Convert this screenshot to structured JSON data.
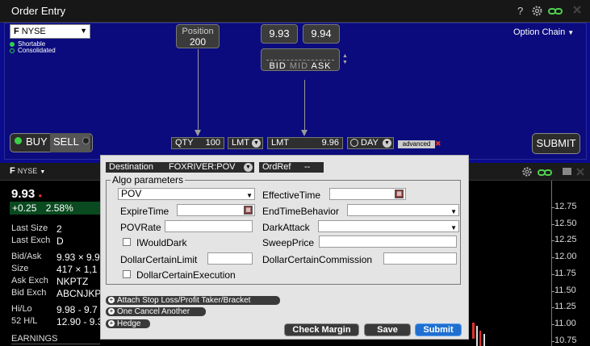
{
  "window": {
    "title": "Order Entry",
    "help": "?"
  },
  "symbol": {
    "ticker": "F",
    "exchange": "NYSE",
    "shortable": "Shortable",
    "consolidated": "Consolidated"
  },
  "position": {
    "label": "Position",
    "value": "200"
  },
  "quote": {
    "bid": "9.93",
    "ask": "9.94",
    "bid_label": "BID",
    "mid_label": "MID",
    "ask_label": "ASK"
  },
  "option_chain": "Option Chain",
  "side": {
    "buy": "BUY",
    "sell": "SELL"
  },
  "order": {
    "qty_label": "QTY",
    "qty": "100",
    "type1": "LMT",
    "type2": "LMT",
    "limit_price": "9.96",
    "tif": "DAY",
    "advanced": "advanced",
    "submit": "SUBMIT"
  },
  "quote_panel": {
    "symbol": "F",
    "exchange": "NYSE",
    "last": "9.93",
    "change": "+0.25",
    "change_pct": "2.58%",
    "rows": [
      {
        "label": "Last Size",
        "value": "2"
      },
      {
        "label": "Last Exch",
        "value": "D"
      },
      {
        "label": "Bid/Ask",
        "value": "9.93 × 9.9"
      },
      {
        "label": "Size",
        "value": "417 × 1,1"
      },
      {
        "label": "Ask Exch",
        "value": "NKPTZ"
      },
      {
        "label": "Bid Exch",
        "value": "ABCNJKPT"
      },
      {
        "label": "Hi/Lo",
        "value": "9.98 - 9.7"
      },
      {
        "label": "52 H/L",
        "value": "12.90 - 9.3"
      }
    ],
    "earnings": "EARNINGS"
  },
  "chart": {
    "y_ticks": [
      "12.75",
      "12.50",
      "12.25",
      "12.00",
      "11.75",
      "11.50",
      "11.25",
      "11.00",
      "10.75"
    ]
  },
  "dialog": {
    "destination_label": "Destination",
    "destination": "FOXRIVER:POV",
    "ordref_label": "OrdRef",
    "ordref": "--",
    "algo_title": "Algo parameters",
    "algo": "POV",
    "fields": {
      "effective_time": "EffectiveTime",
      "expire_time": "ExpireTime",
      "end_time_behavior": "EndTimeBehavior",
      "pov_rate": "POVRate",
      "dark_attack": "DarkAttack",
      "i_would_dark": "IWouldDark",
      "sweep_price": "SweepPrice",
      "dollar_certain_limit": "DollarCertainLimit",
      "dollar_certain_commission": "DollarCertainCommission",
      "dollar_certain_execution": "DollarCertainExecution"
    },
    "links": {
      "attach": "Attach Stop Loss/Profit Taker/Bracket",
      "oca": "One Cancel Another",
      "hedge": "Hedge"
    },
    "buttons": {
      "check_margin": "Check Margin",
      "save": "Save",
      "submit": "Submit"
    }
  }
}
